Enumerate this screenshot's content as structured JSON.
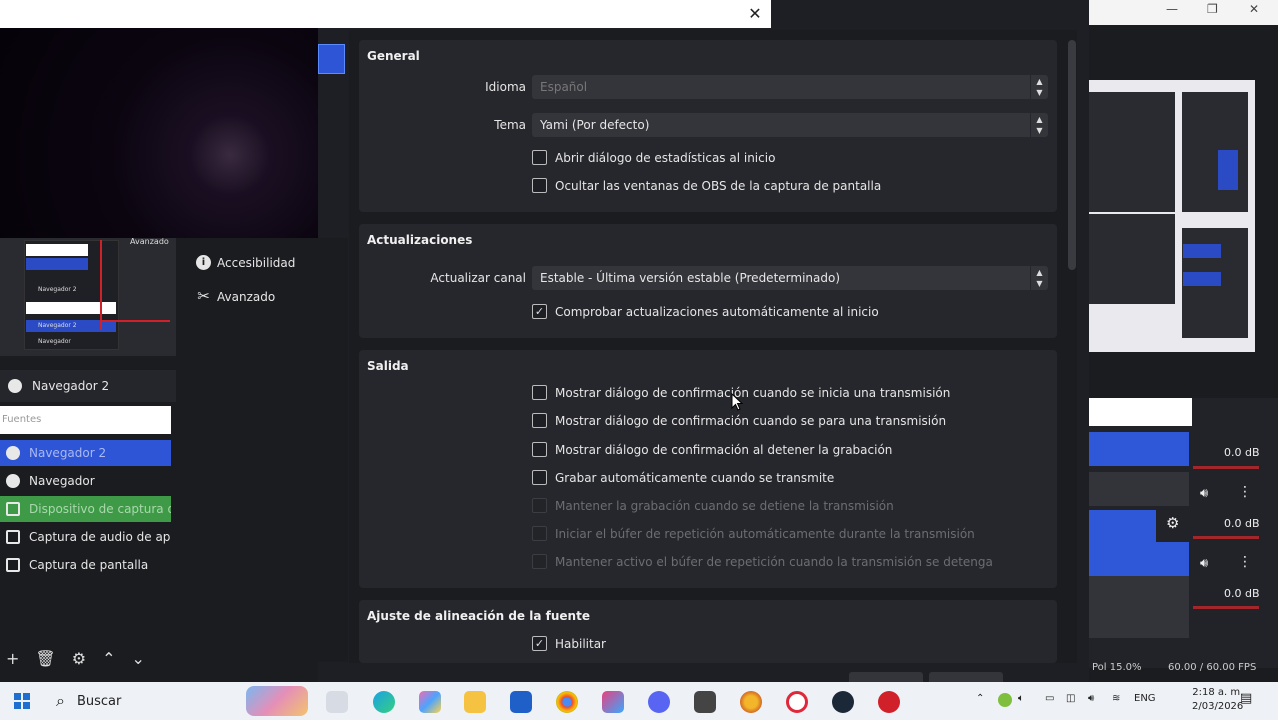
{
  "obs_main": {
    "scene_name": "Navegador 2",
    "sources_filter_placeholder": "Fuentes",
    "sources": [
      {
        "label": "Navegador 2"
      },
      {
        "label": "Navegador"
      },
      {
        "label": "Dispositivo de captura de"
      },
      {
        "label": "Captura de audio de aplica"
      },
      {
        "label": "Captura de pantalla"
      }
    ],
    "preview_labels": [
      "Navegador 2",
      "Navegador 2",
      "Navegador"
    ],
    "preview_side_label": "Avanzado",
    "mixer": [
      {
        "db": "0.0 dB"
      },
      {
        "db": "0.0 dB"
      },
      {
        "db": "0.0 dB"
      }
    ],
    "status_left": "Pol 15.0%",
    "status_fps": "60.00 / 60.00 FPS",
    "accent": "#2d55d6"
  },
  "settings": {
    "nav": [
      {
        "label": "Accesibilidad",
        "icon": "accessibility-icon"
      },
      {
        "label": "Avanzado",
        "icon": "wrench-icon"
      }
    ],
    "general": {
      "title": "General",
      "language_label": "Idioma",
      "language_value": "Español",
      "theme_label": "Tema",
      "theme_value": "Yami (Por defecto)",
      "checks": [
        {
          "label": "Abrir diálogo de estadísticas al inicio",
          "checked": false
        },
        {
          "label": "Ocultar las ventanas de OBS de la captura de pantalla",
          "checked": false
        }
      ]
    },
    "updates": {
      "title": "Actualizaciones",
      "channel_label": "Actualizar canal",
      "channel_value": "Estable - Última versión estable (Predeterminado)",
      "auto_check_label": "Comprobar actualizaciones automáticamente al inicio",
      "auto_check_checked": true
    },
    "output": {
      "title": "Salida",
      "checks": [
        {
          "label": "Mostrar diálogo de confirmación cuando se inicia una transmisión",
          "enabled": true
        },
        {
          "label": "Mostrar diálogo de confirmación cuando se para una transmisión",
          "enabled": true
        },
        {
          "label": "Mostrar diálogo de confirmación al detener la grabación",
          "enabled": true
        },
        {
          "label": "Grabar automáticamente cuando se transmite",
          "enabled": true
        },
        {
          "label": "Mantener la grabación cuando se detiene la transmisión",
          "enabled": false
        },
        {
          "label": "Iniciar el búfer de repetición automáticamente durante la transmisión",
          "enabled": false
        },
        {
          "label": "Mantener activo el búfer de repetición cuando la transmisión se detenga",
          "enabled": false
        }
      ]
    },
    "snapping": {
      "title": "Ajuste de alineación de la fuente",
      "enable_label": "Habilitar",
      "enable_checked": true
    }
  },
  "taskbar": {
    "search_label": "Buscar",
    "language": "ENG",
    "time": "2:18 a. m.",
    "date": "2/03/2026"
  }
}
